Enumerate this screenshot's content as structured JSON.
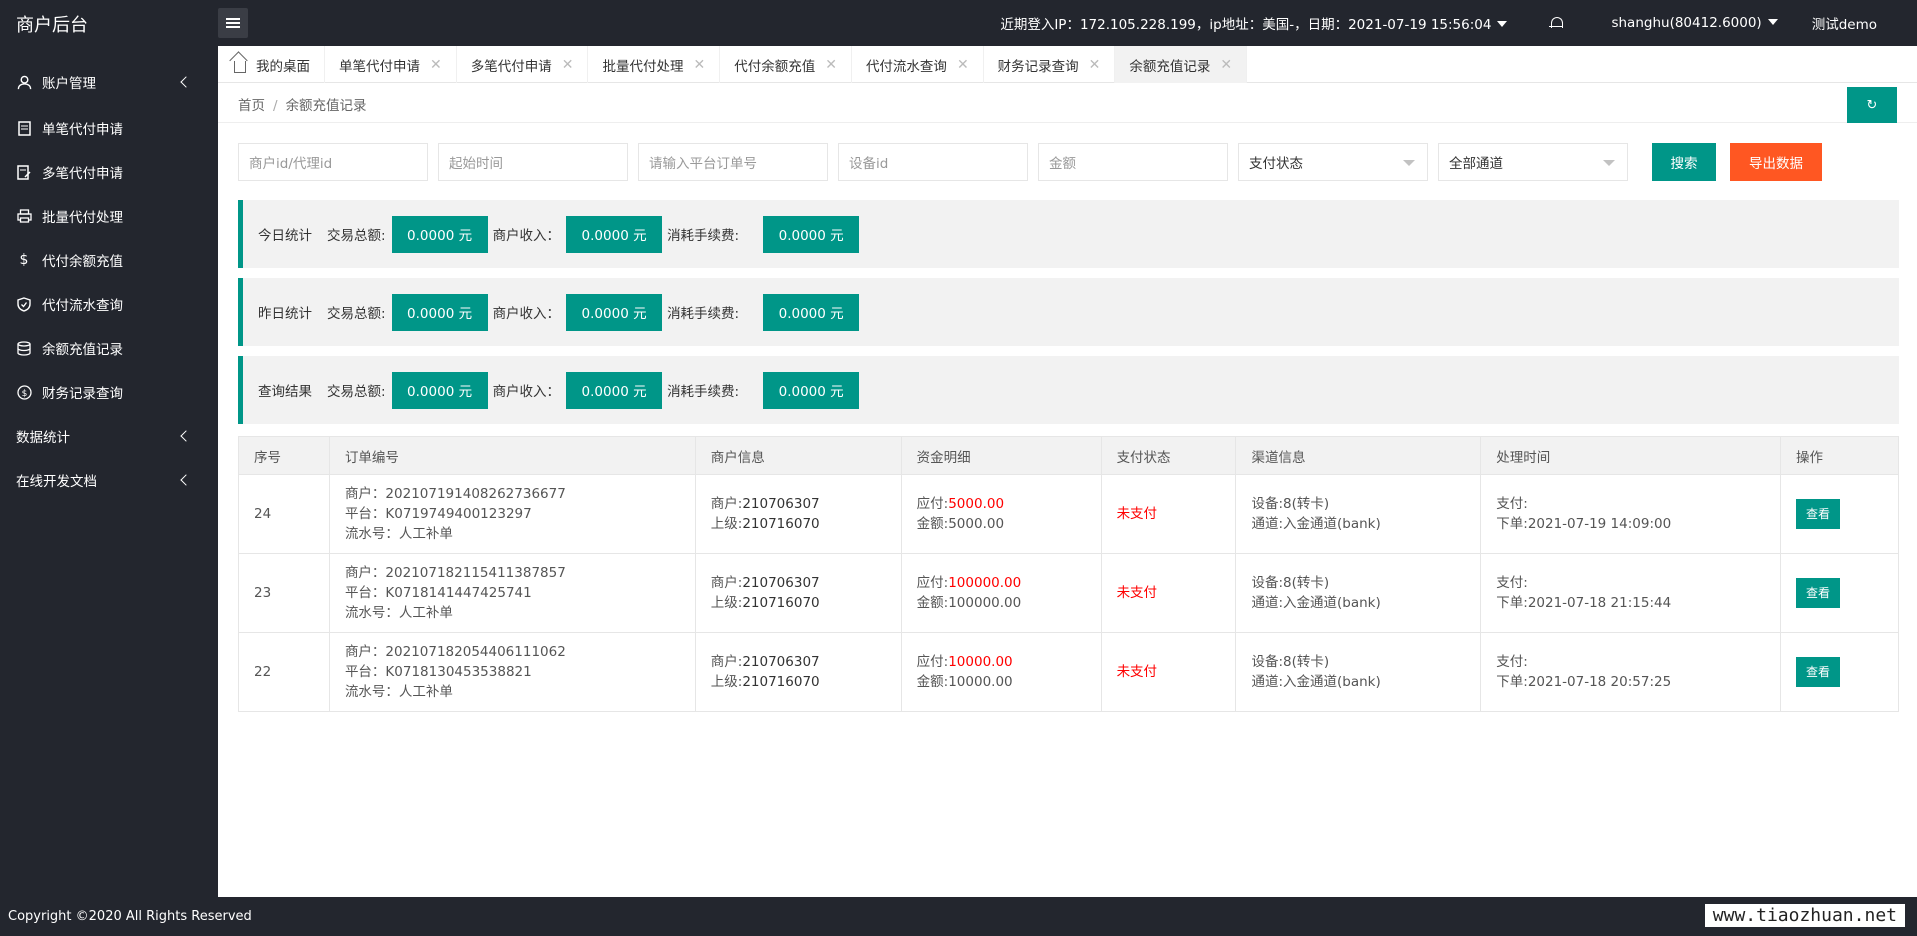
{
  "header": {
    "logo": "商户后台",
    "login_info": "近期登入IP：172.105.228.199，ip地址：美国-，日期：2021-07-19 15:56:04",
    "user": "shanghu(80412.6000)",
    "demo": "测试demo"
  },
  "sidebar": {
    "items": [
      {
        "label": "账户管理",
        "icon": "user-icon"
      },
      {
        "label": "单笔代付申请",
        "icon": "document-icon"
      },
      {
        "label": "多笔代付申请",
        "icon": "document-edit-icon"
      },
      {
        "label": "批量代付处理",
        "icon": "printer-icon"
      },
      {
        "label": "代付余额充值",
        "icon": "dollar-icon"
      },
      {
        "label": "代付流水查询",
        "icon": "shield-icon"
      },
      {
        "label": "余额充值记录",
        "icon": "database-icon"
      },
      {
        "label": "财务记录查询",
        "icon": "coin-icon"
      },
      {
        "label": "数据统计"
      },
      {
        "label": "在线开发文档"
      }
    ]
  },
  "tabs": [
    "我的桌面",
    "单笔代付申请",
    "多笔代付申请",
    "批量代付处理",
    "代付余额充值",
    "代付流水查询",
    "财务记录查询",
    "余额充值记录"
  ],
  "breadcrumb": {
    "home": "首页",
    "sep": "/",
    "current": "余额充值记录"
  },
  "refresh_label": "↻",
  "filters": {
    "merchant_placeholder": "商户id/代理id",
    "start_placeholder": "起始时间",
    "order_placeholder": "请输入平台订单号",
    "device_placeholder": "设备id",
    "amount_placeholder": "金额",
    "pay_status": "支付状态",
    "channel": "全部通道",
    "search_label": "搜索",
    "export_label": "导出数据"
  },
  "stats": [
    {
      "label": "今日统计",
      "total_key": "交易总额:",
      "total": "0.0000 元",
      "income_key": "商户收入：",
      "income": "0.0000 元",
      "fee_key": "消耗手续费:",
      "fee": "0.0000 元"
    },
    {
      "label": "昨日统计",
      "total_key": "交易总额:",
      "total": "0.0000 元",
      "income_key": "商户收入：",
      "income": "0.0000 元",
      "fee_key": "消耗手续费:",
      "fee": "0.0000 元"
    },
    {
      "label": "查询结果",
      "total_key": "交易总额:",
      "total": "0.0000 元",
      "income_key": "商户收入：",
      "income": "0.0000 元",
      "fee_key": "消耗手续费:",
      "fee": "0.0000 元"
    }
  ],
  "table": {
    "headers": [
      "序号",
      "订单编号",
      "商户信息",
      "资金明细",
      "支付状态",
      "渠道信息",
      "处理时间",
      "操作"
    ],
    "rows": [
      {
        "id": "24",
        "merchant_no": "商户：20210719140826273​6677",
        "platform_no": "平台：K0719749400123297",
        "serial": "流水号：人工补单",
        "m1_k": "商户:",
        "m1_v": "210706307",
        "m2_k": "上级:",
        "m2_v": "210716070",
        "due_k": "应付:",
        "due_v": "5000.00",
        "amt_k": "金额:",
        "amt_v": "5000.00",
        "status": "未支付",
        "dev": "设备:8(转卡)",
        "chan": "通道:入金通道(bank)",
        "pay_time": "支付:",
        "order_time": "下单:2021-07-19 14:09:00",
        "action": "查看"
      },
      {
        "id": "23",
        "merchant_no": "商户：202107182115411387857",
        "platform_no": "平台：K0718141447425741",
        "serial": "流水号：人工补单",
        "m1_k": "商户:",
        "m1_v": "210706307",
        "m2_k": "上级:",
        "m2_v": "210716070",
        "due_k": "应付:",
        "due_v": "100000.00",
        "amt_k": "金额:",
        "amt_v": "100000.00",
        "status": "未支付",
        "dev": "设备:8(转卡)",
        "chan": "通道:入金通道(bank)",
        "pay_time": "支付:",
        "order_time": "下单:2021-07-18 21:15:44",
        "action": "查看"
      },
      {
        "id": "22",
        "merchant_no": "商户：202107182054406111062",
        "platform_no": "平台：K0718130453538821",
        "serial": "流水号：人工补单",
        "m1_k": "商户:",
        "m1_v": "210706307",
        "m2_k": "上级:",
        "m2_v": "210716070",
        "due_k": "应付:",
        "due_v": "10000.00",
        "amt_k": "金额:",
        "amt_v": "10000.00",
        "status": "未支付",
        "dev": "设备:8(转卡)",
        "chan": "通道:入金通道(bank)",
        "pay_time": "支付:",
        "order_time": "下单:2021-07-18 20:57:25",
        "action": "查看"
      }
    ]
  },
  "footer": {
    "copyright": "Copyright ©2020 All Rights Reserved",
    "watermark": "www.tiaozhuan.net"
  },
  "colors": {
    "primary": "#009688",
    "danger": "#ff5722",
    "dark": "#23262e",
    "alert": "#ff0000"
  }
}
